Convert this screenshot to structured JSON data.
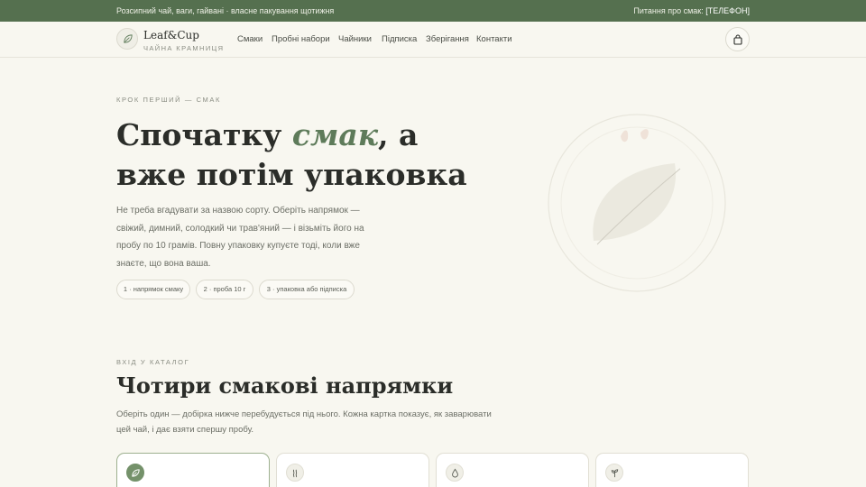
{
  "topbar": {
    "promo": "Розсипний чай, ваги, гайвані · власне пакування щотижня",
    "contact_label": "Питання про смак:",
    "contact_value": "[ТЕЛЕФОН]"
  },
  "brand": {
    "name": "Leaf&Cup",
    "tagline": "ЧАЙНА КРАМНИЦЯ",
    "icon": "leaf-icon"
  },
  "nav": {
    "items": [
      {
        "label": "Смаки"
      },
      {
        "label": "Пробні набори"
      },
      {
        "label": "Чайники"
      },
      {
        "label": "Підписка"
      },
      {
        "label": "Зберігання"
      },
      {
        "label": "Контакти"
      }
    ],
    "cart_icon": "shopping-bag-icon"
  },
  "hero": {
    "eyebrow": "КРОК ПЕРШИЙ — СМАК",
    "title_start": "Спочатку ",
    "title_accent": "смак",
    "title_end": ", а вже потім упаковка",
    "lede": "Не треба вгадувати за назвою сорту. Оберіть напрямок — свіжий, димний, солодкий чи трав'яний — і візьміть його на пробу по 10 грамів. Повну упаковку купуєте тоді, коли вже знаєте, що вона ваша.",
    "steps": [
      {
        "label": "1 · напрямок смаку"
      },
      {
        "label": "2 · проба 10 г"
      },
      {
        "label": "3 · упаковка або підписка"
      }
    ],
    "art_icon": "tea-leaf-illustration"
  },
  "catalog": {
    "eyebrow": "ВХІД У КАТАЛОГ",
    "title": "Чотири смакові напрямки",
    "subtitle": "Оберіть один — добірка нижче перебудується під нього. Кожна картка показує, як заварювати цей чай, і дає взяти спершу пробу.",
    "cards": [
      {
        "icon": "leaf-icon",
        "active": true
      },
      {
        "icon": "smoke-icon",
        "active": false
      },
      {
        "icon": "drop-icon",
        "active": false
      },
      {
        "icon": "sprout-icon",
        "active": false
      }
    ]
  },
  "colors": {
    "accent": "#55704f",
    "accent_text": "#5e7b5a",
    "background": "#f8f7f0"
  }
}
